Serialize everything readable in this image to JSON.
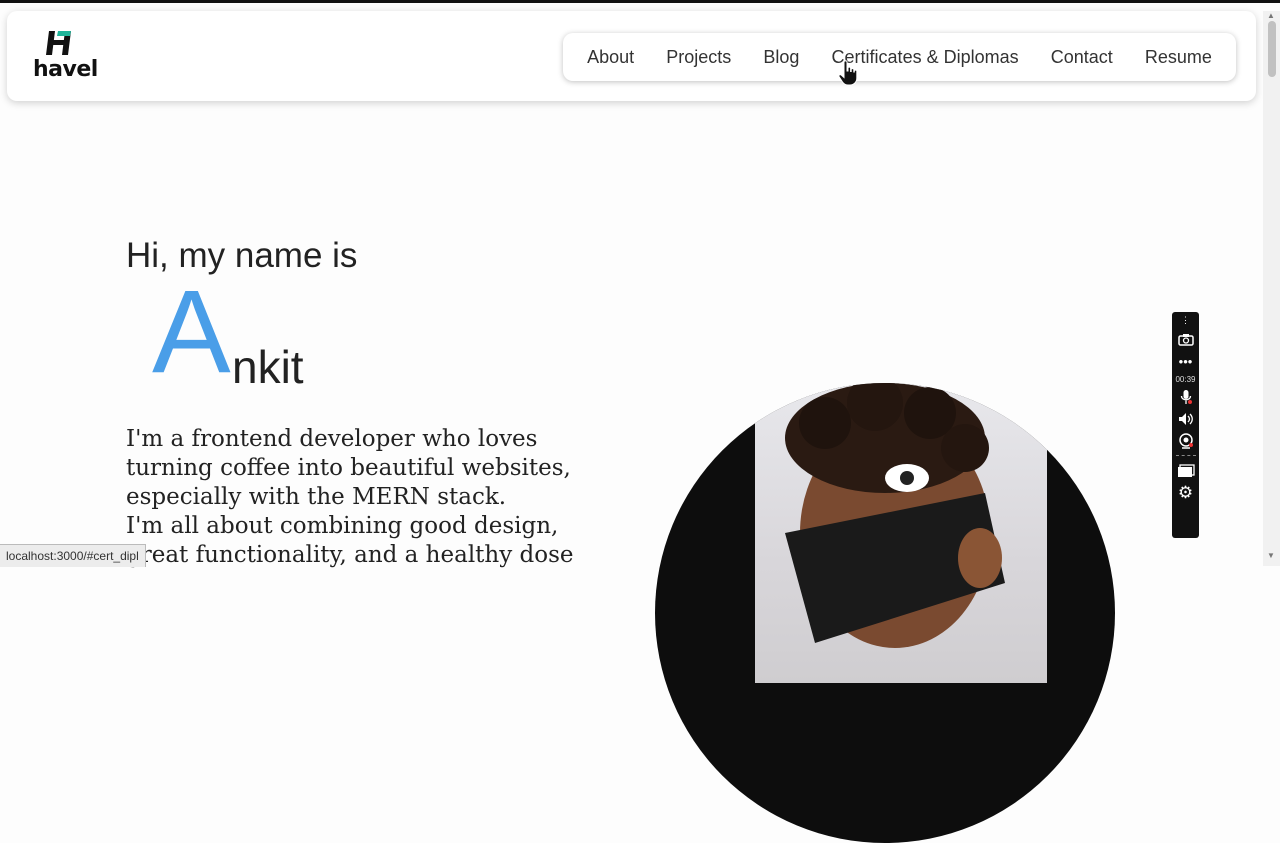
{
  "logo": {
    "mark": "H",
    "text": "havel"
  },
  "nav": {
    "items": [
      {
        "label": "About"
      },
      {
        "label": "Projects"
      },
      {
        "label": "Blog"
      },
      {
        "label": "Certificates & Diplomas"
      },
      {
        "label": "Contact"
      },
      {
        "label": "Resume"
      }
    ]
  },
  "hero": {
    "greeting": "Hi, my name is",
    "name_initial": "A",
    "name_rest": "nkit",
    "bio_lines": [
      "I'm a frontend developer who loves",
      "turning coffee into beautiful websites,",
      "especially with the MERN stack.",
      "I'm all about combining good design,",
      "great functionality, and a healthy dose"
    ]
  },
  "recorder": {
    "elapsed": "00:39"
  },
  "status_bar": {
    "url": "localhost:3000/#cert_dipl"
  },
  "colors": {
    "accent": "#4a9ee8",
    "logo_teal": "#1fb59a",
    "text": "#222222"
  },
  "icons": [
    "hand-pointer-icon",
    "camera-icon",
    "more-icon",
    "microphone-icon",
    "speaker-icon",
    "webcam-icon",
    "screen-icon",
    "gear-icon"
  ]
}
